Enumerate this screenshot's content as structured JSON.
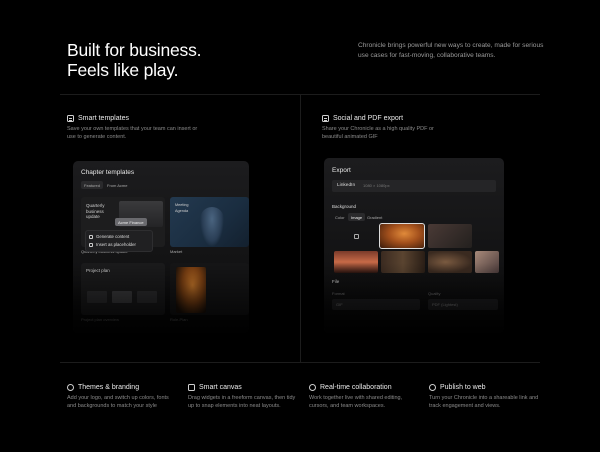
{
  "hero": {
    "title_line1": "Built for business.",
    "title_line2": "Feels like play.",
    "description": "Chronicle brings powerful new ways to create, made for serious use cases for fast-moving, collaborative teams."
  },
  "features_top": [
    {
      "title": "Smart templates",
      "icon": "template-icon",
      "description": "Save your own templates that your team can insert or use to generate content."
    },
    {
      "title": "Social and PDF export",
      "icon": "document-icon",
      "description": "Share your Chronicle as a high quality PDF or beautiful animated GIF"
    }
  ],
  "templates_panel": {
    "title": "Chapter templates",
    "tabs": [
      "Featured",
      "From Acme"
    ],
    "card1_title": "Quarterly business update",
    "card1_badge": "Acme Finance",
    "card1_caption": "Quarterly business update",
    "card2_title": "Meeting Agenda",
    "card2_caption": "Market",
    "card3_title": "Project plan",
    "card3_caption": "Project plan overview",
    "card4_caption": "Role-Plan",
    "menu_items": [
      "Generate content",
      "Insert as placeholder"
    ]
  },
  "export_panel": {
    "title": "Export",
    "format_label": "LinkedIn",
    "format_dims": "1080 × 1080px",
    "background_label": "Background",
    "bg_tabs": [
      "Color",
      "Image",
      "Gradient"
    ],
    "file_label": "File",
    "file_fields": [
      "Format",
      "Quality"
    ],
    "file_values": [
      "GIF",
      "PDF (Lightest)"
    ]
  },
  "features_bottom": [
    {
      "title": "Themes & branding",
      "icon": "palette-icon",
      "description": "Add your logo, and switch up colors, fonts and backgrounds to match your style"
    },
    {
      "title": "Smart canvas",
      "icon": "canvas-icon",
      "description": "Drag widgets in a freeform canvas, then tidy up to snap elements into neat layouts."
    },
    {
      "title": "Real-time collaboration",
      "icon": "collaboration-icon",
      "description": "Work together live with shared editing, cursors, and team workspaces."
    },
    {
      "title": "Publish to web",
      "icon": "globe-icon",
      "description": "Turn your Chronicle into a shareable link and track engagement and views."
    }
  ],
  "colors": {
    "background": "#000000",
    "panel": "#1a1a1b",
    "accent_orange": "#c8641e",
    "accent_blue": "#2a4a66"
  }
}
